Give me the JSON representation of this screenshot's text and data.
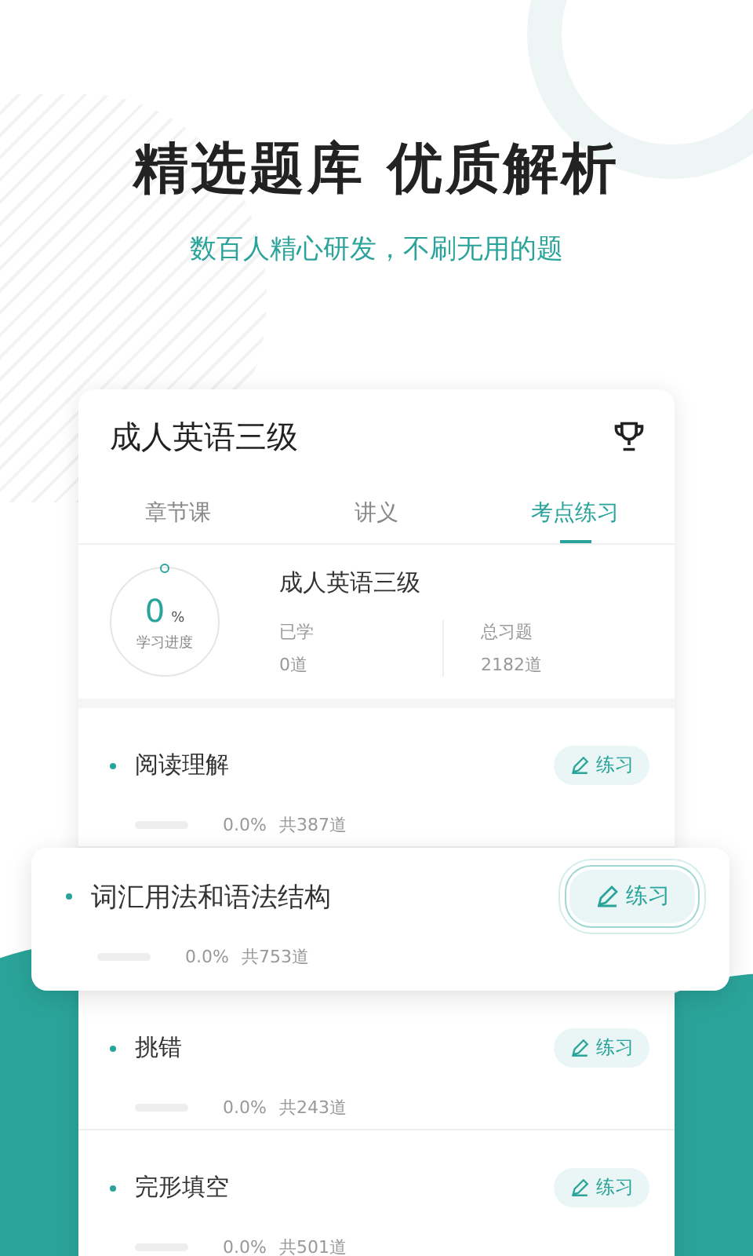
{
  "headline": "精选题库 优质解析",
  "subtitle": "数百人精心研发，不刷无用的题",
  "card": {
    "title": "成人英语三级",
    "tabs": [
      {
        "label": "章节课",
        "selected": false
      },
      {
        "label": "讲义",
        "selected": false
      },
      {
        "label": "考点练习",
        "selected": true
      }
    ],
    "progress": {
      "value": "0",
      "unit": "%",
      "label": "学习进度",
      "course": "成人英语三级",
      "stats": [
        {
          "label": "已学",
          "value": "0道"
        },
        {
          "label": "总习题",
          "value": "2182道"
        }
      ]
    },
    "topics": [
      {
        "name": "阅读理解",
        "level": 0,
        "percent": "0.0%",
        "total": "共387道",
        "button": "练习",
        "highlighted": false
      },
      {
        "name": "词汇用法和语法结构",
        "level": 0,
        "percent": "0.0%",
        "total": "共753道",
        "button": "练习",
        "highlighted": true
      },
      {
        "name": "挑错",
        "level": 0,
        "percent": "0.0%",
        "total": "共243道",
        "button": "练习",
        "highlighted": false
      },
      {
        "name": "完形填空",
        "level": 0,
        "percent": "0.0%",
        "total": "共501道",
        "button": "练习",
        "highlighted": false
      }
    ]
  }
}
